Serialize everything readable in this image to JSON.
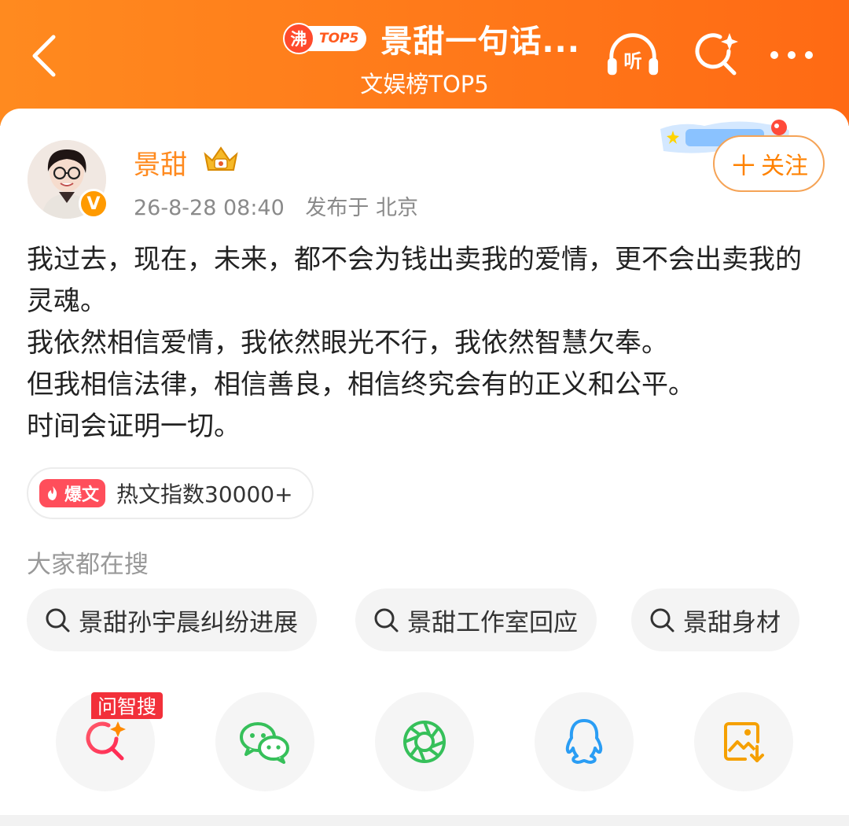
{
  "header": {
    "hot_badge": "沸",
    "top_badge": "TOP5",
    "title": "景甜一句话...",
    "subtitle": "文娱榜TOP5",
    "listen_label": "听",
    "icons": [
      "back-arrow-icon",
      "headphone-listen-icon",
      "ai-search-icon",
      "more-dots-icon"
    ],
    "accent_color": "#ff7a1a"
  },
  "post": {
    "author": "景甜",
    "verified": "V",
    "time": "26-8-28 08:40",
    "location": "发布于 北京",
    "follow_label": "关注",
    "follow_plus": "＋",
    "paragraphs": [
      "我过去，现在，未来，都不会为钱出卖我的爱情，更不会出卖我的灵魂。",
      "我依然相信爱情，我依然眼光不行，我依然智慧欠奉。",
      "但我相信法律，相信善良，相信终究会有的正义和公平。",
      "时间会证明一切。"
    ],
    "hot_tag": "爆文",
    "hot_index": "热文指数30000+"
  },
  "search": {
    "label": "大家都在搜",
    "chips": [
      "景甜孙宇晨纠纷进展",
      "景甜工作室回应",
      "景甜身材"
    ]
  },
  "share": {
    "ask_tag": "问智搜",
    "buttons": [
      "ai-search-icon",
      "wechat-icon",
      "moments-icon",
      "qq-icon",
      "save-image-icon"
    ]
  }
}
